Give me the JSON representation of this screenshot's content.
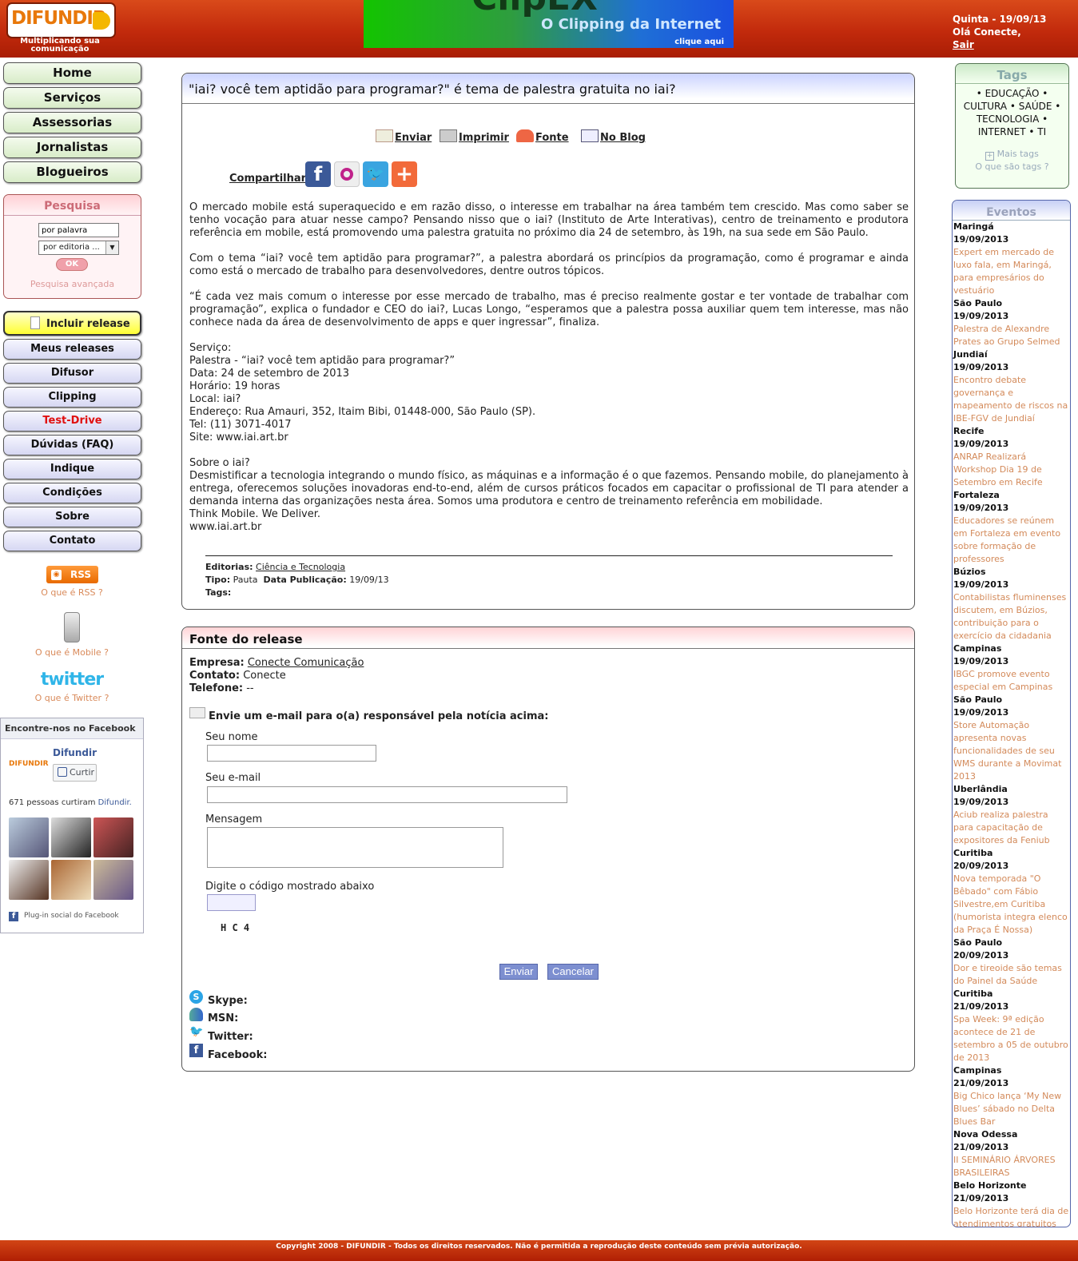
{
  "header": {
    "logo_text": "DIFUNDIR",
    "slogan": "Multiplicando sua comunicação",
    "banner_title": "ClipEX",
    "banner_subtitle": "O Clipping da Internet",
    "banner_link": "clique aqui",
    "date": "Quinta - 19/09/13",
    "greeting": "Olá Conecte,",
    "logout": "Sair"
  },
  "nav_main": [
    "Home",
    "Serviços",
    "Assessorias",
    "Jornalistas",
    "Blogueiros"
  ],
  "search": {
    "title": "Pesquisa",
    "word_placeholder": "por palavra",
    "category_value": "por editoria ...",
    "ok_label": "OK",
    "advanced": "Pesquisa avançada"
  },
  "nav_release": {
    "include": "Incluir release",
    "items": [
      "Meus releases",
      "Difusor",
      "Clipping",
      "Test-Drive",
      "Dúvidas (FAQ)",
      "Indique",
      "Condições",
      "Sobre",
      "Contato"
    ]
  },
  "left_extras": {
    "rss": "RSS",
    "rss_q": "O que é RSS ?",
    "mobile_q": "O que é Mobile ?",
    "twitter_logo": "twitter",
    "twitter_q": "O que é Twitter ?"
  },
  "facebook": {
    "header": "Encontre-nos no Facebook",
    "page_name": "Difundir",
    "like": "Curtir",
    "count_text": "671 pessoas curtiram",
    "count_link": "Difundir.",
    "plugin": "Plug-in social do Facebook"
  },
  "article": {
    "title": "\"iai? você tem aptidão para programar?\" é tema de palestra gratuita no iai?",
    "tools": [
      "Enviar",
      "Imprimir",
      "Fonte",
      "No Blog"
    ],
    "share_label": "Compartilhar:",
    "paragraphs": [
      "O mercado mobile está superaquecido e em razão disso, o interesse em trabalhar na área também tem crescido. Mas como saber se tenho vocação para atuar nesse campo? Pensando nisso que o iai? (Instituto de Arte Interativas), centro de treinamento e produtora referência em mobile, está promovendo uma palestra gratuita no próximo dia 24 de setembro, às 19h, na sua sede em São Paulo.",
      "Com o tema “iai? você tem aptidão para programar?”, a palestra abordará os princípios da programação, como é programar e ainda como está o mercado de trabalho para desenvolvedores, dentre outros tópicos.",
      "“É cada vez mais comum o interesse por esse mercado de trabalho, mas é preciso realmente gostar e ter vontade de trabalhar com programação”, explica o fundador e CEO do iai?, Lucas Longo, “esperamos que a palestra possa auxiliar quem tem interesse, mas não conhece nada da área de desenvolvimento de apps e quer ingressar”, finaliza."
    ],
    "service_lines": [
      "Serviço:",
      "Palestra - “iai? você tem aptidão para programar?”",
      "Data: 24 de setembro de 2013",
      "Horário: 19 horas",
      "Local: iai?",
      "Endereço: Rua Amauri, 352, Itaim Bibi, 01448-000, São Paulo (SP).",
      "Tel: (11) 3071-4017",
      "Site: www.iai.art.br"
    ],
    "about_lines": [
      "Sobre o iai?",
      "Desmistificar a tecnologia integrando o mundo físico, as máquinas e a informação é o que fazemos. Pensando mobile, do planejamento à entrega, oferecemos soluções inovadoras end-to-end, além de cursos práticos focados em capacitar o profissional de TI para atender a demanda interna das organizações nesta área. Somos uma produtora e centro de treinamento referência em mobilidade.",
      "Think Mobile. We Deliver.",
      "www.iai.art.br"
    ],
    "meta": {
      "editorias_label": "Editorias:",
      "editorias_value": "Ciência e Tecnologia",
      "tipo_label": "Tipo:",
      "tipo_value": "Pauta",
      "data_label": "Data Publicação:",
      "data_value": "19/09/13",
      "tags_label": "Tags:"
    }
  },
  "fonte": {
    "title": "Fonte do release",
    "empresa_label": "Empresa:",
    "empresa_value": "Conecte Comunicação",
    "contato_label": "Contato:",
    "contato_value": "Conecte",
    "telefone_label": "Telefone:",
    "telefone_value": "--",
    "email_heading": "Envie um e-mail para o(a) responsável pela notícia acima:",
    "name_label": "Seu nome",
    "email_label": "Seu e-mail",
    "message_label": "Mensagem",
    "code_label": "Digite o código mostrado abaixo",
    "captcha": "H C 4",
    "send": "Enviar",
    "cancel": "Cancelar",
    "skype": "Skype:",
    "msn": "MSN:",
    "twitter": "Twitter:",
    "facebook": "Facebook:"
  },
  "tags": {
    "title": "Tags",
    "line1": "• EDUCAÇÃO •",
    "line2": "CULTURA • SAÚDE •",
    "line3": "TECNOLOGIA •",
    "line4": "INTERNET • TI",
    "more": "Mais tags",
    "what": "O que são tags ?"
  },
  "events": {
    "title": "Eventos",
    "items": [
      {
        "city": "Maringá",
        "date": "19/09/2013",
        "text": "Expert em mercado de luxo fala, em Maringá, para empresários do vestuário"
      },
      {
        "city": "São Paulo",
        "date": "19/09/2013",
        "text": "Palestra de Alexandre Prates ao Grupo Selmed"
      },
      {
        "city": "Jundiaí",
        "date": "19/09/2013",
        "text": "Encontro debate governança e mapeamento de riscos na IBE-FGV de Jundiaí"
      },
      {
        "city": "Recife",
        "date": "19/09/2013",
        "text": "ANRAP Realizará Workshop Dia 19 de Setembro em Recife"
      },
      {
        "city": "Fortaleza",
        "date": "19/09/2013",
        "text": "Educadores se reúnem em Fortaleza em evento sobre formação de professores"
      },
      {
        "city": "Búzios",
        "date": "19/09/2013",
        "text": "Contabilistas fluminenses discutem, em Búzios, contribuição para o exercício da cidadania"
      },
      {
        "city": "Campinas",
        "date": "19/09/2013",
        "text": "IBGC promove evento especial em Campinas"
      },
      {
        "city": "São Paulo",
        "date": "19/09/2013",
        "text": "Store Automação apresenta novas funcionalidades de seu WMS durante a Movimat 2013"
      },
      {
        "city": "Uberlândia",
        "date": "19/09/2013",
        "text": "Aciub realiza palestra para capacitação de expositores da Feniub"
      },
      {
        "city": "Curitiba",
        "date": "20/09/2013",
        "text": "Nova temporada \"O Bêbado\" com Fábio Silvestre,em Curitiba (humorista integra elenco da Praça É Nossa)"
      },
      {
        "city": "São Paulo",
        "date": "20/09/2013",
        "text": "Dor e tireoide são temas do Painel da Saúde"
      },
      {
        "city": "Curitiba",
        "date": "21/09/2013",
        "text": "Spa Week: 9ª edição acontece de 21 de setembro a 05 de outubro de 2013"
      },
      {
        "city": "Campinas",
        "date": "21/09/2013",
        "text": "Big Chico lança ‘My New Blues’ sábado no Delta Blues Bar"
      },
      {
        "city": "Nova Odessa",
        "date": "21/09/2013",
        "text": "II SEMINÁRIO ÁRVORES BRASILEIRAS"
      },
      {
        "city": "Belo Horizonte",
        "date": "21/09/2013",
        "text": "Belo Horizonte terá dia de atendimentos gratuitos para a comunidade"
      }
    ]
  },
  "footer": "Copyright 2008 - DIFUNDIR - Todos os direitos reservados. Não é permitida a reprodução deste conteúdo sem prévia autorização."
}
